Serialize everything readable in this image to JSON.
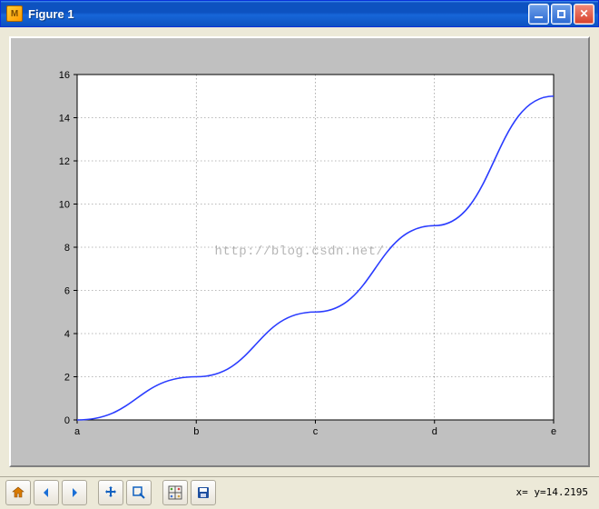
{
  "window": {
    "title": "Figure 1",
    "icon_text": "M"
  },
  "watermark": "http://blog.csdn.net/",
  "status": {
    "text": "x= y=14.2195"
  },
  "toolbar": {
    "home": "Home",
    "back": "Back",
    "forward": "Forward",
    "pan": "Pan",
    "zoom": "Zoom",
    "subplots": "Configure subplots",
    "save": "Save"
  },
  "chart_data": {
    "type": "line",
    "categories": [
      "a",
      "b",
      "c",
      "d",
      "e"
    ],
    "x_numeric": [
      0,
      1,
      2,
      3,
      4
    ],
    "values": [
      0,
      2,
      5,
      9,
      15
    ],
    "xlabel": "",
    "ylabel": "",
    "title": "",
    "ylim": [
      0,
      16
    ],
    "yticks": [
      0,
      2,
      4,
      6,
      8,
      10,
      12,
      14,
      16
    ],
    "grid": true,
    "grid_style": "dotted",
    "line_color": "#2a3cff"
  }
}
